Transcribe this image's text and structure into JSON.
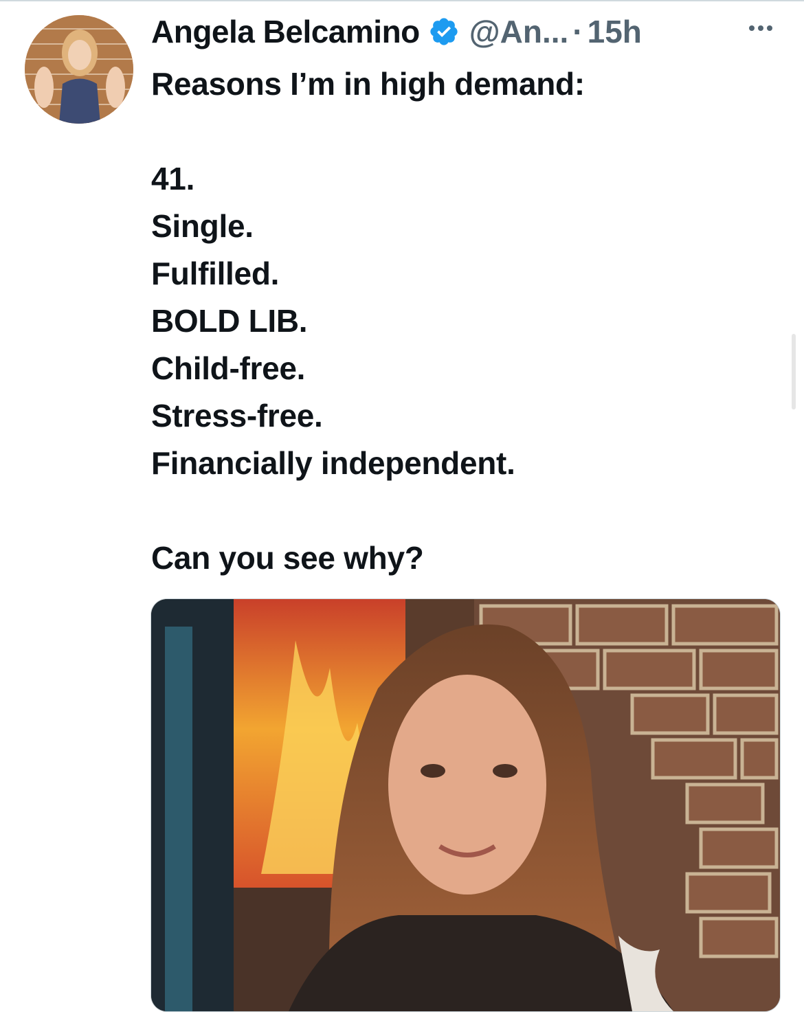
{
  "tweet": {
    "author_name": "Angela Belcamino",
    "handle": "@An...",
    "separator": "·",
    "time": "15h",
    "lines": [
      "Reasons I’m in high demand:",
      "",
      "41.",
      "Single.",
      "Fulfilled.",
      "BOLD LIB.",
      "Child-free.",
      "Stress-free.",
      "Financially independent.",
      "",
      "Can you see why?"
    ]
  },
  "icons": {
    "verified": "verified-badge-icon",
    "more": "more-options-icon"
  },
  "colors": {
    "text": "#0f1419",
    "secondary": "#536471",
    "verified": "#1d9bf0"
  }
}
